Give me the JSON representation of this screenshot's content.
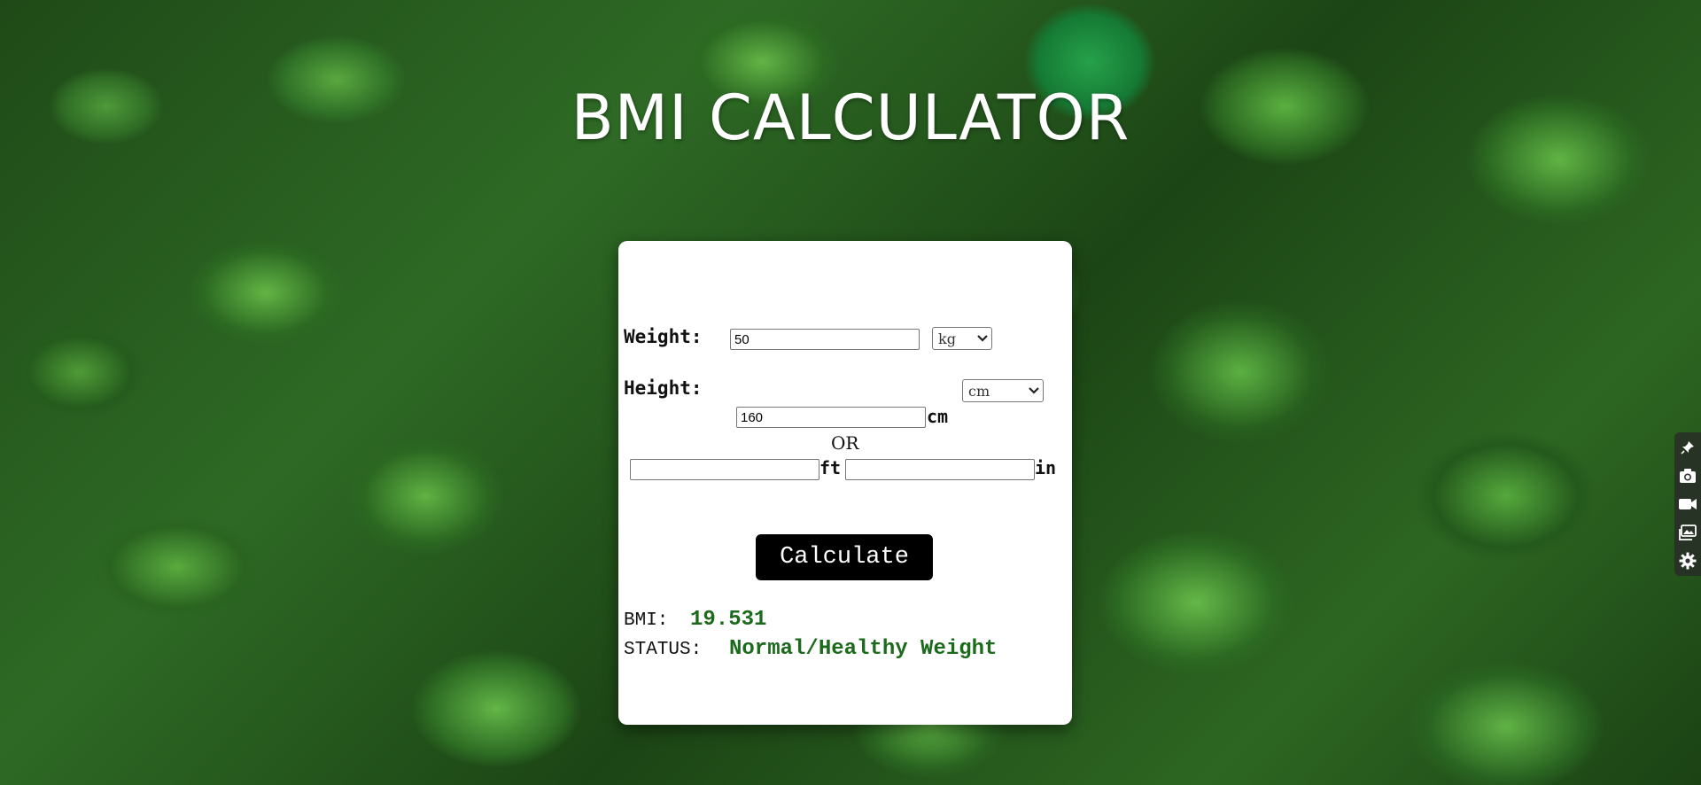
{
  "page": {
    "title": "BMI CALCULATOR"
  },
  "form": {
    "weight_label": "Weight:",
    "weight_value": "50",
    "weight_unit_selected": "kg",
    "height_label": "Height:",
    "height_unit_selected": "cm",
    "height_cm_value": "160",
    "height_cm_unit": "cm",
    "or_label": "OR",
    "height_ft_value": "",
    "height_ft_unit": "ft",
    "height_in_value": "",
    "height_in_unit": "in",
    "calculate_label": "Calculate"
  },
  "result": {
    "bmi_label": "BMI:",
    "bmi_value": "19.531",
    "status_label": "STATUS:",
    "status_value": "Normal/Healthy Weight"
  },
  "colors": {
    "result_green": "#1c6a1c",
    "button_bg": "#000000",
    "card_bg": "#ffffff"
  },
  "toolbar": {
    "icons": [
      "pin-icon",
      "camera-icon",
      "video-icon",
      "gallery-icon",
      "gear-icon"
    ]
  }
}
